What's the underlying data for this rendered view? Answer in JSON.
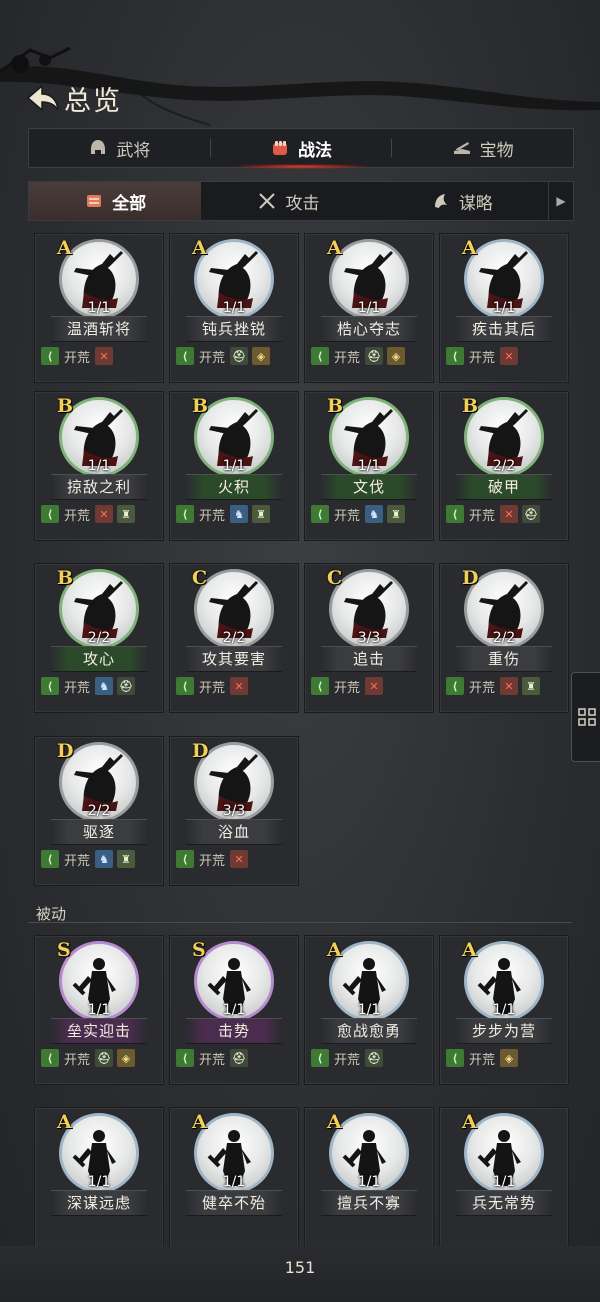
{
  "header": {
    "title": "总览"
  },
  "main_tabs": [
    {
      "label": "武将",
      "icon": "helmet-icon",
      "active": false
    },
    {
      "label": "战法",
      "icon": "fist-icon",
      "active": true
    },
    {
      "label": "宝物",
      "icon": "treasure-icon",
      "active": false
    }
  ],
  "sub_tabs": [
    {
      "label": "全部",
      "icon": "scroll-icon",
      "active": true
    },
    {
      "label": "攻击",
      "icon": "crossed-swords-icon",
      "active": false
    },
    {
      "label": "谋略",
      "icon": "strategy-icon",
      "active": false
    }
  ],
  "active_cards": [
    {
      "grade": "A",
      "count": "1/1",
      "name": "温酒斩将",
      "tag_open": "开荒"
    },
    {
      "grade": "A",
      "count": "1/1",
      "name": "钝兵挫锐",
      "tag_open": "开荒"
    },
    {
      "grade": "A",
      "count": "1/1",
      "name": "梏心夺志",
      "tag_open": "开荒"
    },
    {
      "grade": "A",
      "count": "1/1",
      "name": "疾击其后",
      "tag_open": "开荒"
    },
    {
      "grade": "B",
      "count": "1/1",
      "name": "掠敌之利",
      "tag_open": "开荒"
    },
    {
      "grade": "B",
      "count": "1/1",
      "name": "火积",
      "tag_open": "开荒"
    },
    {
      "grade": "B",
      "count": "1/1",
      "name": "文伐",
      "tag_open": "开荒"
    },
    {
      "grade": "B",
      "count": "2/2",
      "name": "破甲",
      "tag_open": "开荒"
    },
    {
      "grade": "B",
      "count": "2/2",
      "name": "攻心",
      "tag_open": "开荒"
    },
    {
      "grade": "C",
      "count": "2/2",
      "name": "攻其要害",
      "tag_open": "开荒"
    },
    {
      "grade": "C",
      "count": "3/3",
      "name": "追击",
      "tag_open": "开荒"
    },
    {
      "grade": "D",
      "count": "2/2",
      "name": "重伤",
      "tag_open": "开荒"
    },
    {
      "grade": "D",
      "count": "2/2",
      "name": "驱逐",
      "tag_open": "开荒"
    },
    {
      "grade": "D",
      "count": "3/3",
      "name": "浴血",
      "tag_open": "开荒"
    }
  ],
  "passive_section": {
    "label": "被动"
  },
  "passive_cards": [
    {
      "grade": "S",
      "count": "1/1",
      "name": "垒实迎击",
      "tag_open": "开荒"
    },
    {
      "grade": "S",
      "count": "1/1",
      "name": "击势",
      "tag_open": "开荒"
    },
    {
      "grade": "A",
      "count": "1/1",
      "name": "愈战愈勇",
      "tag_open": "开荒"
    },
    {
      "grade": "A",
      "count": "1/1",
      "name": "步步为营",
      "tag_open": "开荒"
    },
    {
      "grade": "A",
      "count": "1/1",
      "name": "深谋远虑",
      "tag_open": ""
    },
    {
      "grade": "A",
      "count": "1/1",
      "name": "健卒不殆",
      "tag_open": ""
    },
    {
      "grade": "A",
      "count": "1/1",
      "name": "擅兵不寡",
      "tag_open": ""
    },
    {
      "grade": "A",
      "count": "1/1",
      "name": "兵无常势",
      "tag_open": ""
    }
  ],
  "footer": {
    "page_number": "151"
  },
  "colors": {
    "grade": "#f2cf57",
    "active_tab_glow": "#e23a2a",
    "tag_green": "#3e7a34",
    "tag_red": "#ff6b5b"
  }
}
